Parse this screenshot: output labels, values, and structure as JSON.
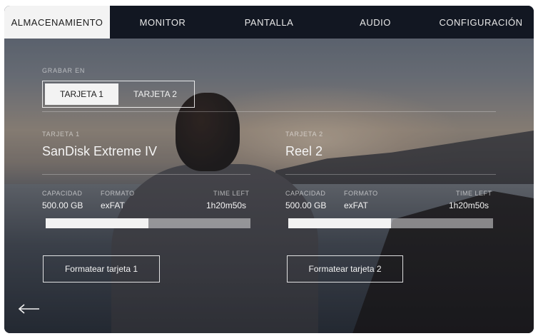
{
  "tabs": [
    {
      "label": "ALMACENAMIENTO",
      "active": true
    },
    {
      "label": "MONITOR",
      "active": false
    },
    {
      "label": "PANTALLA",
      "active": false
    },
    {
      "label": "AUDIO",
      "active": false
    },
    {
      "label": "CONFIGURACIÓN",
      "active": false
    }
  ],
  "record_to": {
    "label": "GRABAR EN",
    "options": [
      "TARJETA 1",
      "TARJETA 2"
    ],
    "selected": "TARJETA 1"
  },
  "cards": [
    {
      "slot_label": "TARJETA 1",
      "name": "SanDisk Extreme IV",
      "capacity_label": "CAPACIDAD",
      "capacity": "500.00 GB",
      "format_label": "FORMATO",
      "format": "exFAT",
      "time_left_label": "TIME LEFT",
      "time_left": "1h20m50s",
      "used_fraction": 0.5,
      "format_button": "Formatear tarjeta 1"
    },
    {
      "slot_label": "TARJETA 2",
      "name": "Reel 2",
      "capacity_label": "CAPACIDAD",
      "capacity": "500.00 GB",
      "format_label": "FORMATO",
      "format": "exFAT",
      "time_left_label": "TIME LEFT",
      "time_left": "1h20m50s",
      "used_fraction": 0.5,
      "format_button": "Formatear tarjeta 2"
    }
  ],
  "back_icon": "arrow-left-icon",
  "colors": {
    "active_tab_bg": "#f3f3f3",
    "tabbar_bg": "#121722"
  }
}
